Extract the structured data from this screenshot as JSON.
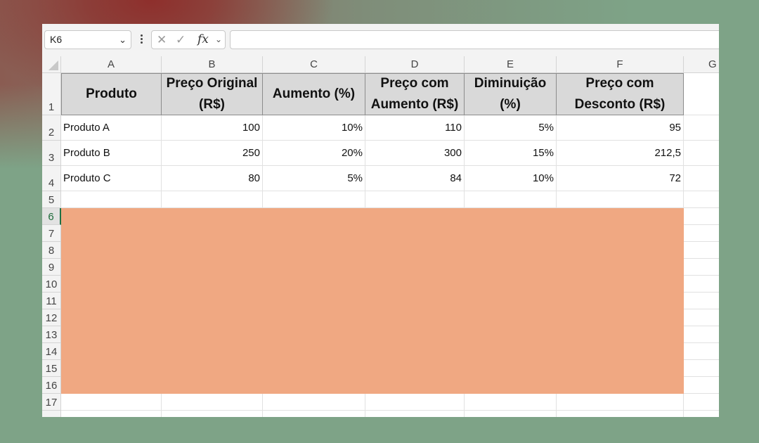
{
  "formula_bar": {
    "name_box": "K6",
    "cancel_icon": "close-icon",
    "enter_icon": "checkmark-icon",
    "fx_label": "fx",
    "formula_value": ""
  },
  "columns": [
    "A",
    "B",
    "C",
    "D",
    "E",
    "F",
    "G"
  ],
  "rows": [
    "1",
    "2",
    "3",
    "4",
    "5",
    "6",
    "7",
    "8",
    "9",
    "10",
    "11",
    "12",
    "13",
    "14",
    "15",
    "16",
    "17"
  ],
  "active_row": "6",
  "table": {
    "headers": {
      "a": "Produto",
      "b1": "Preço Original",
      "b2": "(R$)",
      "c": "Aumento (%)",
      "d1": "Preço com",
      "d2": "Aumento (R$)",
      "e1": "Diminuição",
      "e2": "(%)",
      "f1": "Preço com",
      "f2": "Desconto (R$)"
    },
    "rows": [
      {
        "produto": "Produto A",
        "original": "100",
        "aumento_pct": "10%",
        "com_aumento": "110",
        "diminuicao": "5%",
        "com_desconto": "95"
      },
      {
        "produto": "Produto B",
        "original": "250",
        "aumento_pct": "20%",
        "com_aumento": "300",
        "diminuicao": "15%",
        "com_desconto": "212,5"
      },
      {
        "produto": "Produto C",
        "original": "80",
        "aumento_pct": "5%",
        "com_aumento": "84",
        "diminuicao": "10%",
        "com_desconto": "72"
      }
    ]
  },
  "colors": {
    "header_fill": "#d9d9d9",
    "overlay_fill": "#f0a882",
    "active_accent": "#1e7145"
  }
}
